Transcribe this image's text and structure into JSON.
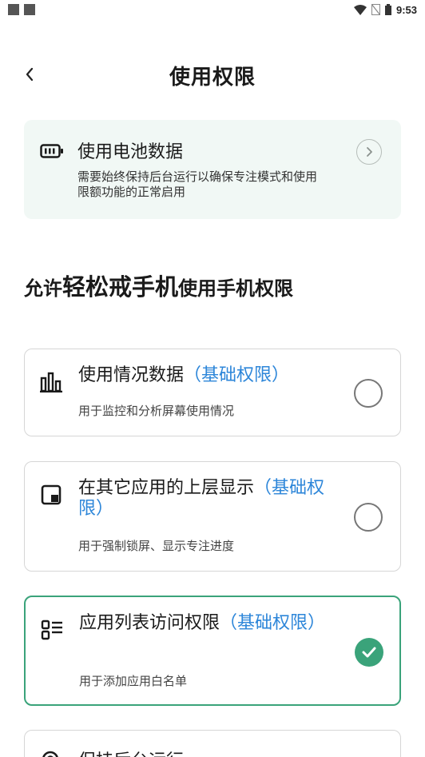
{
  "status_bar": {
    "time": "9:53",
    "icons": [
      "notification-square-icon",
      "notification-square-icon",
      "wifi-icon",
      "no-sim-icon",
      "battery-icon"
    ]
  },
  "header": {
    "back_icon": "chevron-left-icon",
    "title": "使用权限"
  },
  "battery_card": {
    "icon": "battery-icon",
    "title": "使用电池数据",
    "description": "需要始终保持后台运行以确保专注模式和使用限额功能的正常启用",
    "action_icon": "chevron-right-icon"
  },
  "section": {
    "prefix": "允许",
    "app_name": "轻松戒手机",
    "suffix": "使用手机权限"
  },
  "permissions": [
    {
      "icon": "bar-chart-icon",
      "title": "使用情况数据",
      "tag": "（基础权限）",
      "description": "用于监控和分析屏幕使用情况",
      "granted": false
    },
    {
      "icon": "overlay-window-icon",
      "title": "在其它应用的上层显示",
      "tag": "（基础权限）",
      "description": "用于强制锁屏、显示专注进度",
      "granted": false
    },
    {
      "icon": "app-list-icon",
      "title": "应用列表访问权限",
      "tag": "（基础权限）",
      "description": "用于添加应用白名单",
      "granted": true
    }
  ],
  "bottom_card": {
    "icon": "gear-icon",
    "title": "保持后台运行"
  },
  "colors": {
    "accent_green": "#3aa37a",
    "tag_blue": "#2d86d9",
    "card_bg": "#f1f8f5"
  }
}
